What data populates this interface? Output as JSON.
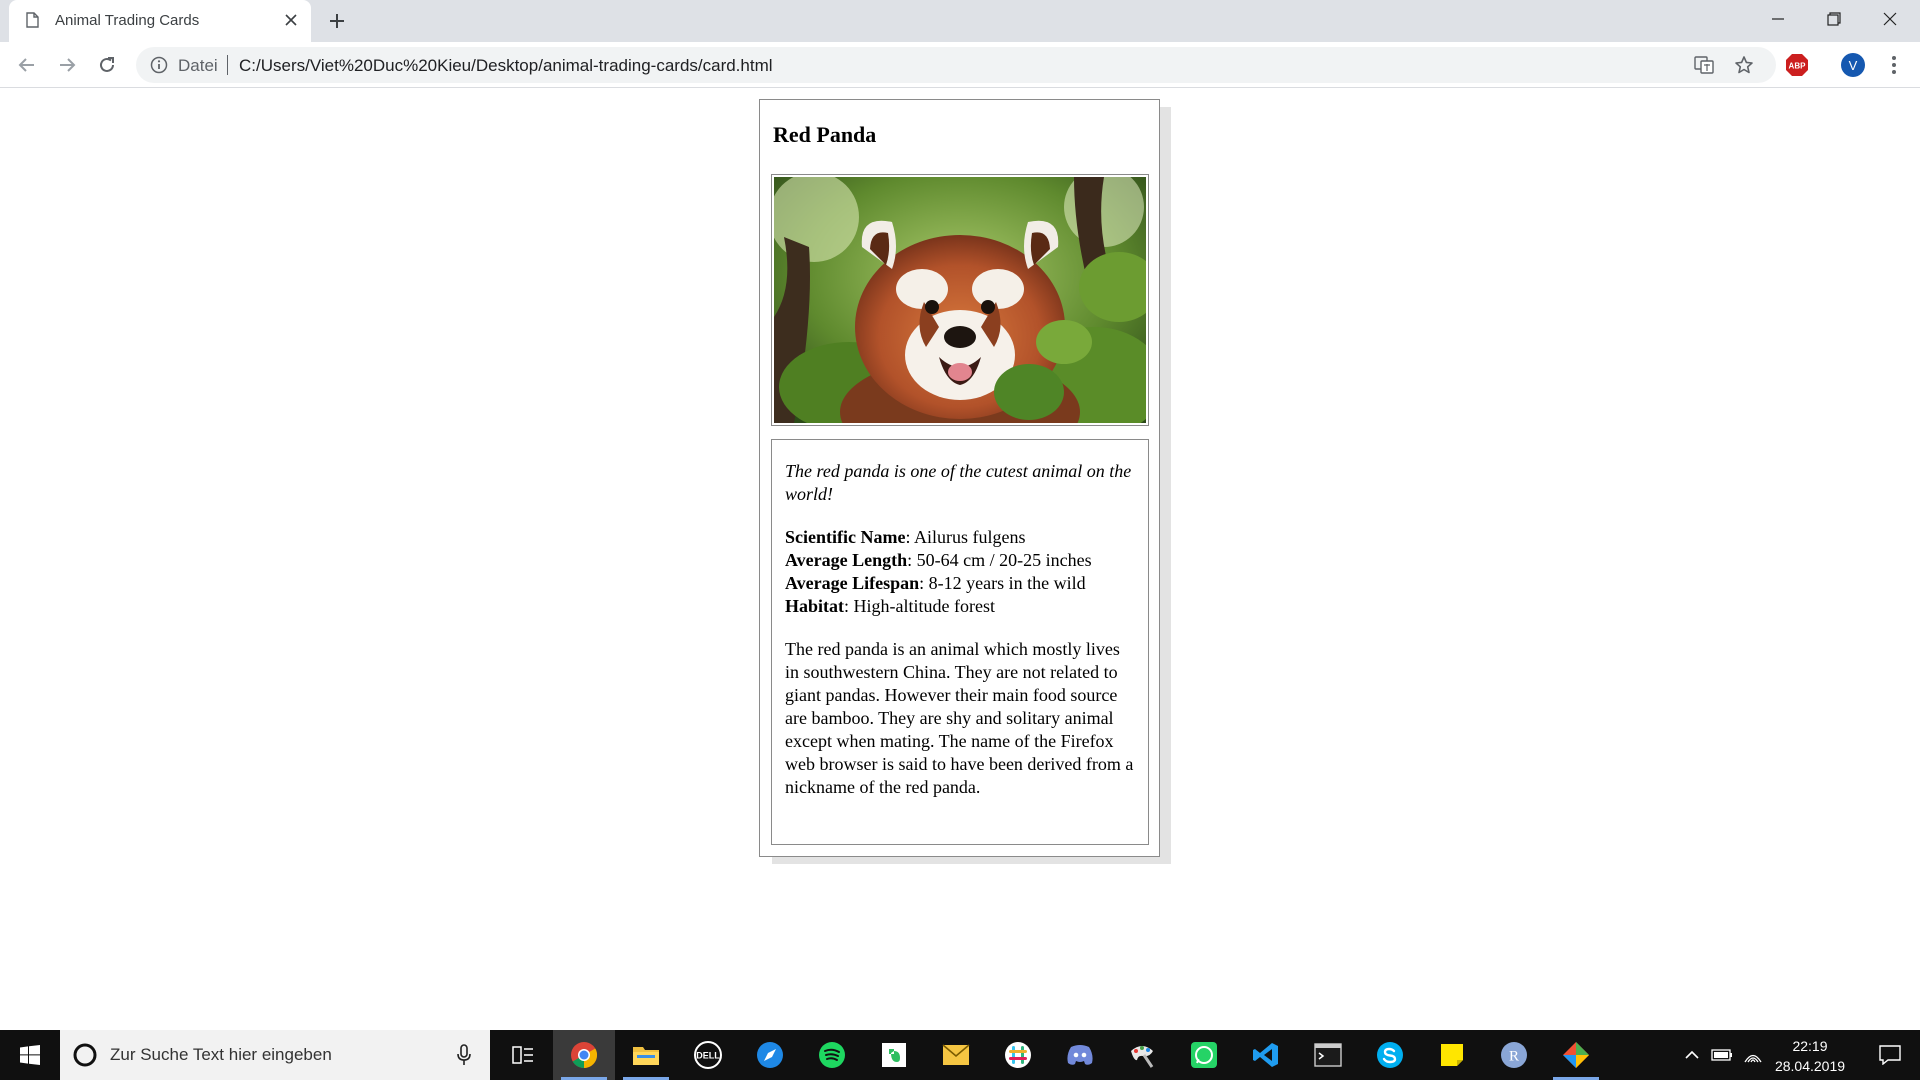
{
  "browser": {
    "tab_title": "Animal Trading Cards",
    "url_scheme_label": "Datei",
    "url": "C:/Users/Viet%20Duc%20Kieu/Desktop/animal-trading-cards/card.html",
    "adblock_label": "ABP",
    "profile_initial": "V"
  },
  "card": {
    "title": "Red Panda",
    "quote": "The red panda is one of the cutest animal on the world!",
    "facts": [
      {
        "label": "Scientific Name",
        "value": ": Ailurus fulgens"
      },
      {
        "label": "Average Length",
        "value": ": 50-64 cm / 20-25 inches"
      },
      {
        "label": "Average Lifespan",
        "value": ": 8-12 years in the wild"
      },
      {
        "label": "Habitat",
        "value": ": High-altitude forest"
      }
    ],
    "description": "The red panda is an animal which mostly lives in southwestern China. They are not related to giant pandas. However their main food source are bamboo. They are shy and solitary animal except when mating. The name of the Firefox web browser is said to have been derived from a nickname of the red panda."
  },
  "taskbar": {
    "search_placeholder": "Zur Suche Text hier eingeben",
    "app_r_label": "R",
    "clock_time": "22:19",
    "clock_date": "28.04.2019"
  },
  "colors": {
    "tabstrip_bg": "#dee1e6",
    "taskbar_bg": "#101010",
    "card_border": "#8a8a8a",
    "abp_red": "#cc1f1f",
    "profile_blue": "#1558b0"
  },
  "icons": [
    "file-icon",
    "close-icon",
    "plus-icon",
    "minimize-icon",
    "restore-icon",
    "back-arrow-icon",
    "forward-arrow-icon",
    "reload-icon",
    "info-icon",
    "translate-icon",
    "star-icon",
    "adblock-icon",
    "menu-dots-icon",
    "windows-logo-icon",
    "cortana-icon",
    "microphone-icon",
    "task-view-icon",
    "chrome-icon",
    "file-explorer-icon",
    "dell-icon",
    "safari-icon",
    "spotify-icon",
    "evernote-icon",
    "mail-icon",
    "slack-icon",
    "discord-icon",
    "paint-icon",
    "whatsapp-icon",
    "vscode-icon",
    "terminal-icon",
    "skype-icon",
    "sticky-notes-icon",
    "r-app-icon",
    "git-kraken-icon",
    "chevron-up-icon",
    "battery-icon",
    "wifi-icon",
    "notifications-icon"
  ]
}
